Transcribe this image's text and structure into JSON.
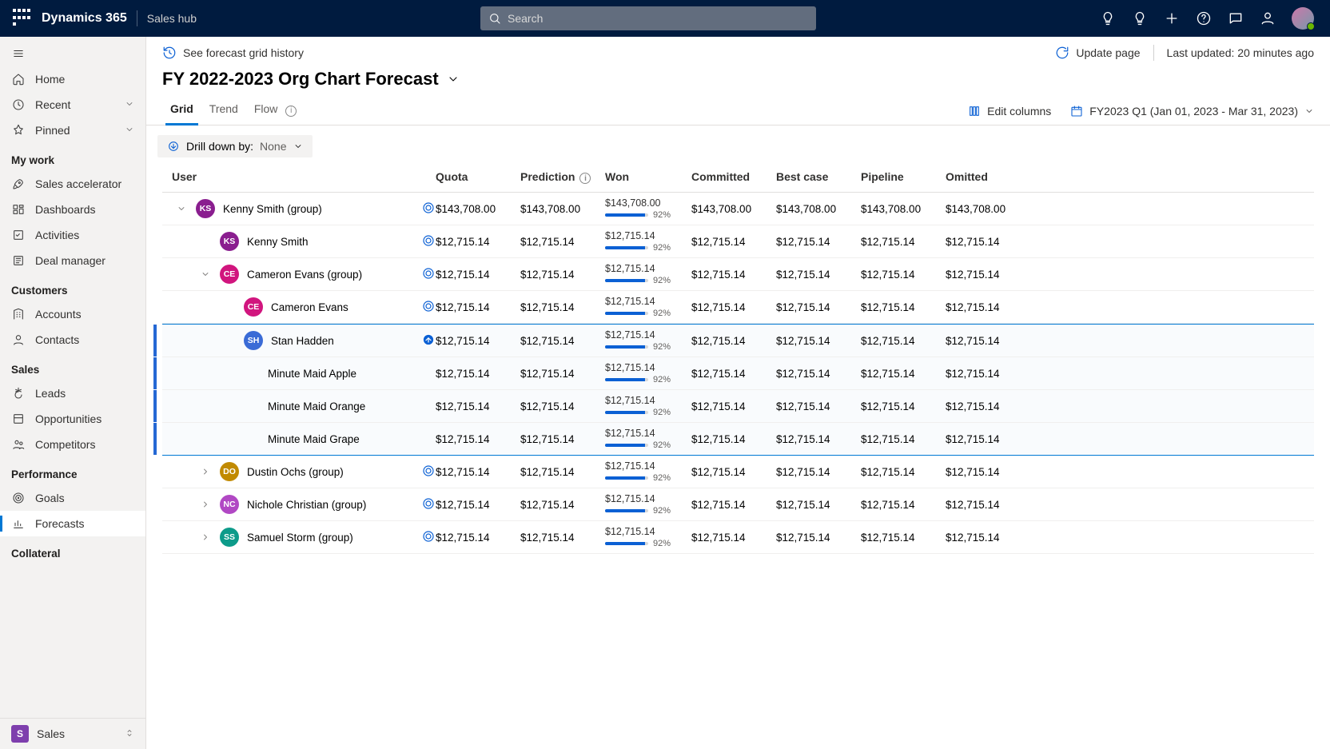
{
  "header": {
    "brand": "Dynamics 365",
    "module": "Sales hub",
    "search_placeholder": "Search"
  },
  "sidebar": {
    "top": [
      {
        "icon": "home",
        "label": "Home"
      },
      {
        "icon": "clock",
        "label": "Recent",
        "chevron": true
      },
      {
        "icon": "pin",
        "label": "Pinned",
        "chevron": true
      }
    ],
    "groups": [
      {
        "label": "My work",
        "items": [
          {
            "icon": "rocket",
            "label": "Sales accelerator"
          },
          {
            "icon": "dashboard",
            "label": "Dashboards"
          },
          {
            "icon": "activity",
            "label": "Activities"
          },
          {
            "icon": "deal",
            "label": "Deal manager"
          }
        ]
      },
      {
        "label": "Customers",
        "items": [
          {
            "icon": "building",
            "label": "Accounts"
          },
          {
            "icon": "person",
            "label": "Contacts"
          }
        ]
      },
      {
        "label": "Sales",
        "items": [
          {
            "icon": "lead",
            "label": "Leads"
          },
          {
            "icon": "opp",
            "label": "Opportunities"
          },
          {
            "icon": "comp",
            "label": "Competitors"
          }
        ]
      },
      {
        "label": "Performance",
        "items": [
          {
            "icon": "target",
            "label": "Goals"
          },
          {
            "icon": "chart",
            "label": "Forecasts",
            "active": true
          }
        ]
      },
      {
        "label": "Collateral",
        "items": []
      }
    ],
    "bottom": {
      "badge": "S",
      "label": "Sales"
    }
  },
  "cmdbar": {
    "history_link": "See forecast grid history",
    "update_label": "Update page",
    "last_updated": "Last updated: 20 minutes ago"
  },
  "page_title": "FY 2022-2023 Org Chart Forecast",
  "tabs": [
    {
      "label": "Grid",
      "active": true
    },
    {
      "label": "Trend"
    },
    {
      "label": "Flow",
      "info": true
    }
  ],
  "tools": {
    "edit_columns": "Edit columns",
    "period": "FY2023 Q1 (Jan 01, 2023 - Mar 31, 2023)"
  },
  "drill": {
    "label": "Drill down by:",
    "value": "None"
  },
  "columns": [
    "User",
    "Quota",
    "Prediction",
    "Won",
    "Committed",
    "Best case",
    "Pipeline",
    "Omitted"
  ],
  "rows": [
    {
      "indent": 0,
      "chev": "down",
      "avatar": "KS",
      "cls": "ks",
      "name": "Kenny Smith (group)",
      "adj": true,
      "quota": "$143,708.00",
      "prediction": "$143,708.00",
      "won": "$143,708.00",
      "pct": "92%",
      "pctw": 92,
      "committed": "$143,708.00",
      "best": "$143,708.00",
      "pipeline": "$143,708.00",
      "omitted": "$143,708.00"
    },
    {
      "indent": 1,
      "avatar": "KS",
      "cls": "ks",
      "name": "Kenny Smith",
      "adj": true,
      "quota": "$12,715.14",
      "prediction": "$12,715.14",
      "won": "$12,715.14",
      "pct": "92%",
      "pctw": 92,
      "committed": "$12,715.14",
      "best": "$12,715.14",
      "pipeline": "$12,715.14",
      "omitted": "$12,715.14"
    },
    {
      "indent": 1,
      "chev": "down",
      "avatar": "CE",
      "cls": "ce",
      "name": "Cameron Evans (group)",
      "adj": true,
      "quota": "$12,715.14",
      "prediction": "$12,715.14",
      "won": "$12,715.14",
      "pct": "92%",
      "pctw": 92,
      "committed": "$12,715.14",
      "best": "$12,715.14",
      "pipeline": "$12,715.14",
      "omitted": "$12,715.14"
    },
    {
      "indent": 2,
      "avatar": "CE",
      "cls": "ce",
      "name": "Cameron Evans",
      "adj": true,
      "quota": "$12,715.14",
      "prediction": "$12,715.14",
      "won": "$12,715.14",
      "pct": "92%",
      "pctw": 92,
      "committed": "$12,715.14",
      "best": "$12,715.14",
      "pipeline": "$12,715.14",
      "omitted": "$12,715.14"
    },
    {
      "indent": 2,
      "avatar": "SH",
      "cls": "sh",
      "name": "Stan Hadden",
      "adj": "up",
      "selstart": true,
      "quota": "$12,715.14",
      "prediction": "$12,715.14",
      "won": "$12,715.14",
      "pct": "92%",
      "pctw": 92,
      "committed": "$12,715.14",
      "best": "$12,715.14",
      "pipeline": "$12,715.14",
      "omitted": "$12,715.14"
    },
    {
      "indent": 3,
      "name": "Minute Maid Apple",
      "sel": true,
      "quota": "$12,715.14",
      "prediction": "$12,715.14",
      "won": "$12,715.14",
      "pct": "92%",
      "pctw": 92,
      "committed": "$12,715.14",
      "best": "$12,715.14",
      "pipeline": "$12,715.14",
      "omitted": "$12,715.14"
    },
    {
      "indent": 3,
      "name": "Minute Maid Orange",
      "sel": true,
      "quota": "$12,715.14",
      "prediction": "$12,715.14",
      "won": "$12,715.14",
      "pct": "92%",
      "pctw": 92,
      "committed": "$12,715.14",
      "best": "$12,715.14",
      "pipeline": "$12,715.14",
      "omitted": "$12,715.14"
    },
    {
      "indent": 3,
      "name": "Minute Maid Grape",
      "sel": true,
      "selend": true,
      "quota": "$12,715.14",
      "prediction": "$12,715.14",
      "won": "$12,715.14",
      "pct": "92%",
      "pctw": 92,
      "committed": "$12,715.14",
      "best": "$12,715.14",
      "pipeline": "$12,715.14",
      "omitted": "$12,715.14"
    },
    {
      "indent": 1,
      "chev": "right",
      "avatar": "DO",
      "cls": "doo",
      "name": "Dustin Ochs (group)",
      "adj": true,
      "quota": "$12,715.14",
      "prediction": "$12,715.14",
      "won": "$12,715.14",
      "pct": "92%",
      "pctw": 92,
      "committed": "$12,715.14",
      "best": "$12,715.14",
      "pipeline": "$12,715.14",
      "omitted": "$12,715.14"
    },
    {
      "indent": 1,
      "chev": "right",
      "avatar": "NC",
      "cls": "nc",
      "name": "Nichole Christian (group)",
      "adj": true,
      "quota": "$12,715.14",
      "prediction": "$12,715.14",
      "won": "$12,715.14",
      "pct": "92%",
      "pctw": 92,
      "committed": "$12,715.14",
      "best": "$12,715.14",
      "pipeline": "$12,715.14",
      "omitted": "$12,715.14"
    },
    {
      "indent": 1,
      "chev": "right",
      "avatar": "SS",
      "cls": "ss",
      "name": "Samuel Storm (group)",
      "adj": true,
      "quota": "$12,715.14",
      "prediction": "$12,715.14",
      "won": "$12,715.14",
      "pct": "92%",
      "pctw": 92,
      "committed": "$12,715.14",
      "best": "$12,715.14",
      "pipeline": "$12,715.14",
      "omitted": "$12,715.14"
    }
  ]
}
